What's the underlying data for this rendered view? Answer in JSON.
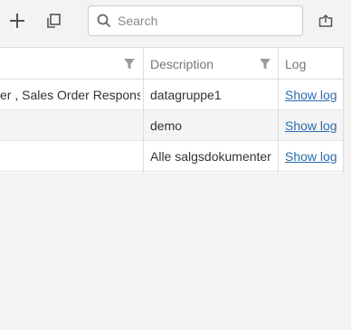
{
  "toolbar": {
    "add_icon": "plus-icon",
    "copy_icon": "copy-icon",
    "export_icon": "export-icon"
  },
  "search": {
    "placeholder": "Search",
    "value": ""
  },
  "grid": {
    "columns": [
      {
        "key": "name",
        "label": ""
      },
      {
        "key": "description",
        "label": "Description"
      },
      {
        "key": "log",
        "label": "Log"
      }
    ],
    "rows": [
      {
        "name": "er , Sales Order Response",
        "description": "datagruppe1",
        "log": "Show log"
      },
      {
        "name": "",
        "description": "demo",
        "log": "Show log"
      },
      {
        "name": "",
        "description": "Alle salgsdokumenter",
        "log": "Show log"
      }
    ]
  },
  "colors": {
    "link": "#2a6db0",
    "header_text": "#777777",
    "filter_icon": "#9a9a9a"
  }
}
